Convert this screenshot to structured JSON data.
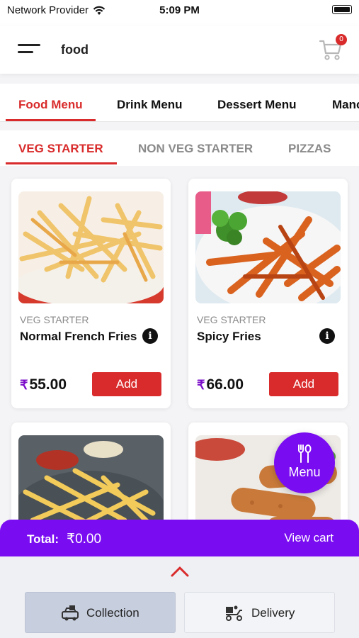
{
  "status_bar": {
    "carrier": "Network Provider",
    "time": "5:09 PM"
  },
  "header": {
    "title": "food",
    "cart_count": "0"
  },
  "menu_tabs": [
    {
      "label": "Food Menu",
      "active": true
    },
    {
      "label": "Drink Menu",
      "active": false
    },
    {
      "label": "Dessert Menu",
      "active": false
    },
    {
      "label": "Manc",
      "active": false
    }
  ],
  "sub_tabs": [
    {
      "label": "VEG STARTER",
      "active": true
    },
    {
      "label": "NON VEG STARTER",
      "active": false
    },
    {
      "label": "PIZZAS",
      "active": false
    }
  ],
  "products": [
    {
      "category": "VEG STARTER",
      "name": "Normal French Fries",
      "currency": "₹",
      "price": "55.00",
      "add_label": "Add"
    },
    {
      "category": "VEG STARTER",
      "name": "Spicy Fries",
      "currency": "₹",
      "price": "66.00",
      "add_label": "Add"
    }
  ],
  "fab": {
    "label": "Menu"
  },
  "total_bar": {
    "label": "Total:",
    "value": "₹0.00",
    "view_cart": "View cart"
  },
  "order_mode": {
    "collection": "Collection",
    "delivery": "Delivery"
  },
  "colors": {
    "accent_red": "#d92b2b",
    "accent_purple": "#7a0cf2"
  }
}
